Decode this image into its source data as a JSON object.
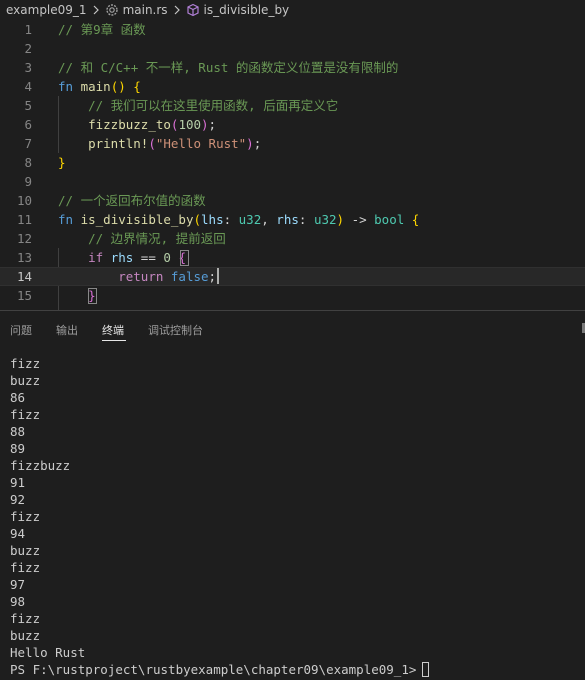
{
  "breadcrumb": {
    "folder": "example09_1",
    "file": "main.rs",
    "symbol": "is_divisible_by"
  },
  "editor": {
    "line_numbers": [
      "1",
      "2",
      "3",
      "4",
      "5",
      "6",
      "7",
      "8",
      "9",
      "10",
      "11",
      "12",
      "13",
      "14",
      "15"
    ],
    "current_line": "14",
    "lines": [
      [
        {
          "t": "// 第9章 函数",
          "c": "cm"
        }
      ],
      [],
      [
        {
          "t": "// 和 C/C++ 不一样, Rust 的函数定义位置是没有限制的",
          "c": "cm"
        }
      ],
      [
        {
          "t": "fn",
          "c": "kw"
        },
        {
          "t": " ",
          "c": "ws"
        },
        {
          "t": "main",
          "c": "fn"
        },
        {
          "t": "()",
          "c": "b1"
        },
        {
          "t": " ",
          "c": "ws"
        },
        {
          "t": "{",
          "c": "b1"
        }
      ],
      [
        {
          "t": "    ",
          "c": "ws"
        },
        {
          "t": "// 我们可以在这里使用函数, 后面再定义它",
          "c": "cm"
        }
      ],
      [
        {
          "t": "    ",
          "c": "ws"
        },
        {
          "t": "fizzbuzz_to",
          "c": "fn"
        },
        {
          "t": "(",
          "c": "b2"
        },
        {
          "t": "100",
          "c": "num"
        },
        {
          "t": ")",
          "c": "b2"
        },
        {
          "t": ";",
          "c": "op"
        }
      ],
      [
        {
          "t": "    ",
          "c": "ws"
        },
        {
          "t": "println!",
          "c": "fn"
        },
        {
          "t": "(",
          "c": "b2"
        },
        {
          "t": "\"Hello Rust\"",
          "c": "str"
        },
        {
          "t": ")",
          "c": "b2"
        },
        {
          "t": ";",
          "c": "op"
        }
      ],
      [
        {
          "t": "}",
          "c": "b1"
        }
      ],
      [],
      [
        {
          "t": "// 一个返回布尔值的函数",
          "c": "cm"
        }
      ],
      [
        {
          "t": "fn",
          "c": "kw"
        },
        {
          "t": " ",
          "c": "ws"
        },
        {
          "t": "is_divisible_by",
          "c": "fn"
        },
        {
          "t": "(",
          "c": "b1"
        },
        {
          "t": "lhs",
          "c": "id"
        },
        {
          "t": ": ",
          "c": "op"
        },
        {
          "t": "u32",
          "c": "ty"
        },
        {
          "t": ", ",
          "c": "op"
        },
        {
          "t": "rhs",
          "c": "id"
        },
        {
          "t": ": ",
          "c": "op"
        },
        {
          "t": "u32",
          "c": "ty"
        },
        {
          "t": ")",
          "c": "b1"
        },
        {
          "t": " -> ",
          "c": "op"
        },
        {
          "t": "bool",
          "c": "ty"
        },
        {
          "t": " ",
          "c": "ws"
        },
        {
          "t": "{",
          "c": "b1"
        }
      ],
      [
        {
          "t": "    ",
          "c": "ws"
        },
        {
          "t": "// 边界情况, 提前返回",
          "c": "cm"
        }
      ],
      [
        {
          "t": "    ",
          "c": "ws"
        },
        {
          "t": "if",
          "c": "ctl"
        },
        {
          "t": " ",
          "c": "ws"
        },
        {
          "t": "rhs",
          "c": "id"
        },
        {
          "t": " == ",
          "c": "op"
        },
        {
          "t": "0",
          "c": "num"
        },
        {
          "t": " ",
          "c": "ws"
        },
        {
          "t": "{",
          "c": "b2"
        }
      ],
      [
        {
          "t": "        ",
          "c": "ws"
        },
        {
          "t": "return",
          "c": "ctl"
        },
        {
          "t": " ",
          "c": "ws"
        },
        {
          "t": "false",
          "c": "kw"
        },
        {
          "t": ";",
          "c": "op"
        }
      ],
      [
        {
          "t": "    ",
          "c": "ws"
        },
        {
          "t": "}",
          "c": "b2"
        }
      ]
    ]
  },
  "panel": {
    "tabs": [
      "问题",
      "输出",
      "终端",
      "调试控制台"
    ],
    "active_tab": "终端"
  },
  "terminal": {
    "lines": [
      "fizz",
      "buzz",
      "86",
      "fizz",
      "88",
      "89",
      "fizzbuzz",
      "91",
      "92",
      "fizz",
      "94",
      "buzz",
      "fizz",
      "97",
      "98",
      "fizz",
      "buzz",
      "Hello Rust"
    ],
    "prompt": "PS F:\\rustproject\\rustbyexample\\chapter09\\example09_1>"
  },
  "colors": {
    "background": "#1e1e1e",
    "comment": "#6a9955",
    "keyword": "#569cd6",
    "function": "#dcdcaa",
    "variable": "#9cdcfe",
    "type": "#4ec9b0",
    "number": "#b5cea8",
    "string": "#ce9178",
    "control": "#c586c0",
    "bracket_level1": "#ffd700",
    "bracket_level2": "#da70d6"
  },
  "icons": {
    "breadcrumb_separator": "chevron-right-icon",
    "file": "rust-file-icon",
    "symbol": "method-cube-icon"
  }
}
